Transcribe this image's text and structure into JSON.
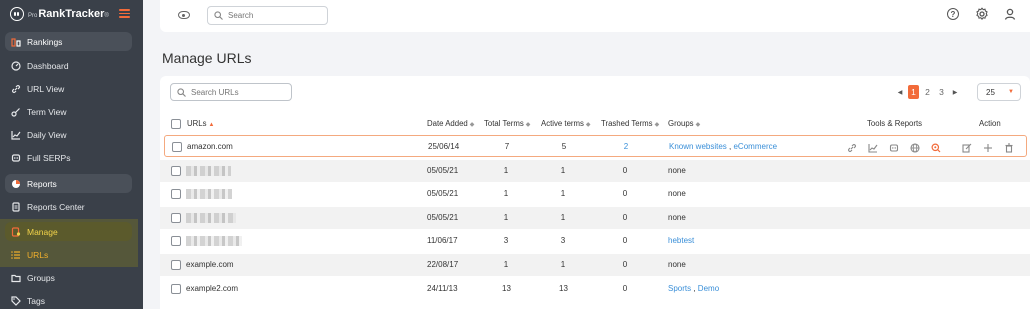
{
  "app": {
    "logo_prefix": "Pro",
    "logo_name": "RankTracker",
    "logo_tm": "®"
  },
  "sidebar": {
    "items": [
      {
        "label": "Rankings",
        "icon": "rankings-icon",
        "kind": "section"
      },
      {
        "label": "Dashboard",
        "icon": "dashboard-icon"
      },
      {
        "label": "URL View",
        "icon": "link-icon"
      },
      {
        "label": "Term View",
        "icon": "key-icon"
      },
      {
        "label": "Daily View",
        "icon": "chart-icon"
      },
      {
        "label": "Full SERPs",
        "icon": "robot-icon"
      },
      {
        "label": "Reports",
        "icon": "pie-icon",
        "kind": "section"
      },
      {
        "label": "Reports Center",
        "icon": "document-icon"
      },
      {
        "label": "Manage",
        "icon": "manage-icon",
        "kind": "active-section"
      },
      {
        "label": "URLs",
        "icon": "list-icon",
        "kind": "active"
      },
      {
        "label": "Groups",
        "icon": "folder-icon"
      },
      {
        "label": "Tags",
        "icon": "tag-icon"
      }
    ]
  },
  "header": {
    "search_placeholder": "Search"
  },
  "page": {
    "title": "Manage URLs"
  },
  "toolbar": {
    "search_placeholder": "Search URLs",
    "pages": [
      "1",
      "2",
      "3"
    ],
    "current_page": "1",
    "per_page": "25"
  },
  "table": {
    "columns": {
      "urls": "URLs",
      "date_added": "Date Added",
      "total_terms": "Total Terms",
      "active_terms": "Active terms",
      "trashed_terms": "Trashed Terms",
      "groups": "Groups",
      "tools": "Tools & Reports",
      "action": "Action"
    },
    "rows": [
      {
        "url": "amazon.com",
        "date": "25/06/14",
        "total": "7",
        "active": "5",
        "trashed": "2",
        "groups": [
          "Known websites",
          "eCommerce"
        ]
      },
      {
        "url": "",
        "date": "05/05/21",
        "total": "1",
        "active": "1",
        "trashed": "0",
        "groups_text": "none"
      },
      {
        "url": "",
        "date": "05/05/21",
        "total": "1",
        "active": "1",
        "trashed": "0",
        "groups_text": "none"
      },
      {
        "url": "",
        "date": "05/05/21",
        "total": "1",
        "active": "1",
        "trashed": "0",
        "groups_text": "none"
      },
      {
        "url": "",
        "date": "11/06/17",
        "total": "3",
        "active": "3",
        "trashed": "0",
        "groups": [
          "hebtest"
        ]
      },
      {
        "url": "example.com",
        "date": "22/08/17",
        "total": "1",
        "active": "1",
        "trashed": "0",
        "groups_text": "none"
      },
      {
        "url": "example2.com",
        "date": "24/11/13",
        "total": "13",
        "active": "13",
        "trashed": "0",
        "groups": [
          "Sports",
          "Demo"
        ]
      }
    ]
  },
  "colors": {
    "accent": "#f26b3a",
    "link": "#3a8fd8",
    "sidebar_bg": "#3a4049",
    "manage_highlight": "#f2d34a"
  }
}
